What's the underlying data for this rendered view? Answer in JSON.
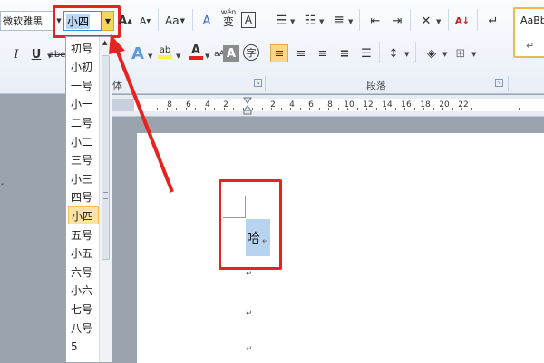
{
  "ribbon": {
    "font_name": "微软雅黑",
    "font_size": "小四",
    "grow_font_icon": "A",
    "shrink_font_icon": "A",
    "change_case_label": "Aa",
    "clear_format_label": "A",
    "phonetic_label": "wén",
    "phonetic_char": "变",
    "border_label": "A",
    "italic": "I",
    "underline": "U",
    "strikethrough": "abe",
    "font_color_label": "A",
    "char_shade_label": "A",
    "enclose_label": "字",
    "highlight_label": "ab",
    "text_effect_label": "A",
    "char_border_label": "aA",
    "font_group_label": "体",
    "paragraph_group_label": "段落",
    "style_sample": "AaBb",
    "style_return": "↵"
  },
  "colors": {
    "highlight_red": "#e8231f",
    "selected_item": "#fbe3a3",
    "selection_blue": "#b6d3ef",
    "arrow_yellow": "#f7d460"
  },
  "ruler": {
    "labels": [
      "8",
      "6",
      "4",
      "2",
      "2",
      "4",
      "6",
      "8",
      "10",
      "12",
      "14",
      "16",
      "18",
      "20",
      "22"
    ]
  },
  "font_sizes": {
    "items": [
      "初号",
      "小初",
      "一号",
      "小一",
      "二号",
      "小二",
      "三号",
      "小三",
      "四号",
      "小四",
      "五号",
      "小五",
      "六号",
      "小六",
      "七号",
      "八号",
      "5"
    ],
    "selected": "小四"
  },
  "document": {
    "selected_text": "哈",
    "return_mark": "↵"
  }
}
